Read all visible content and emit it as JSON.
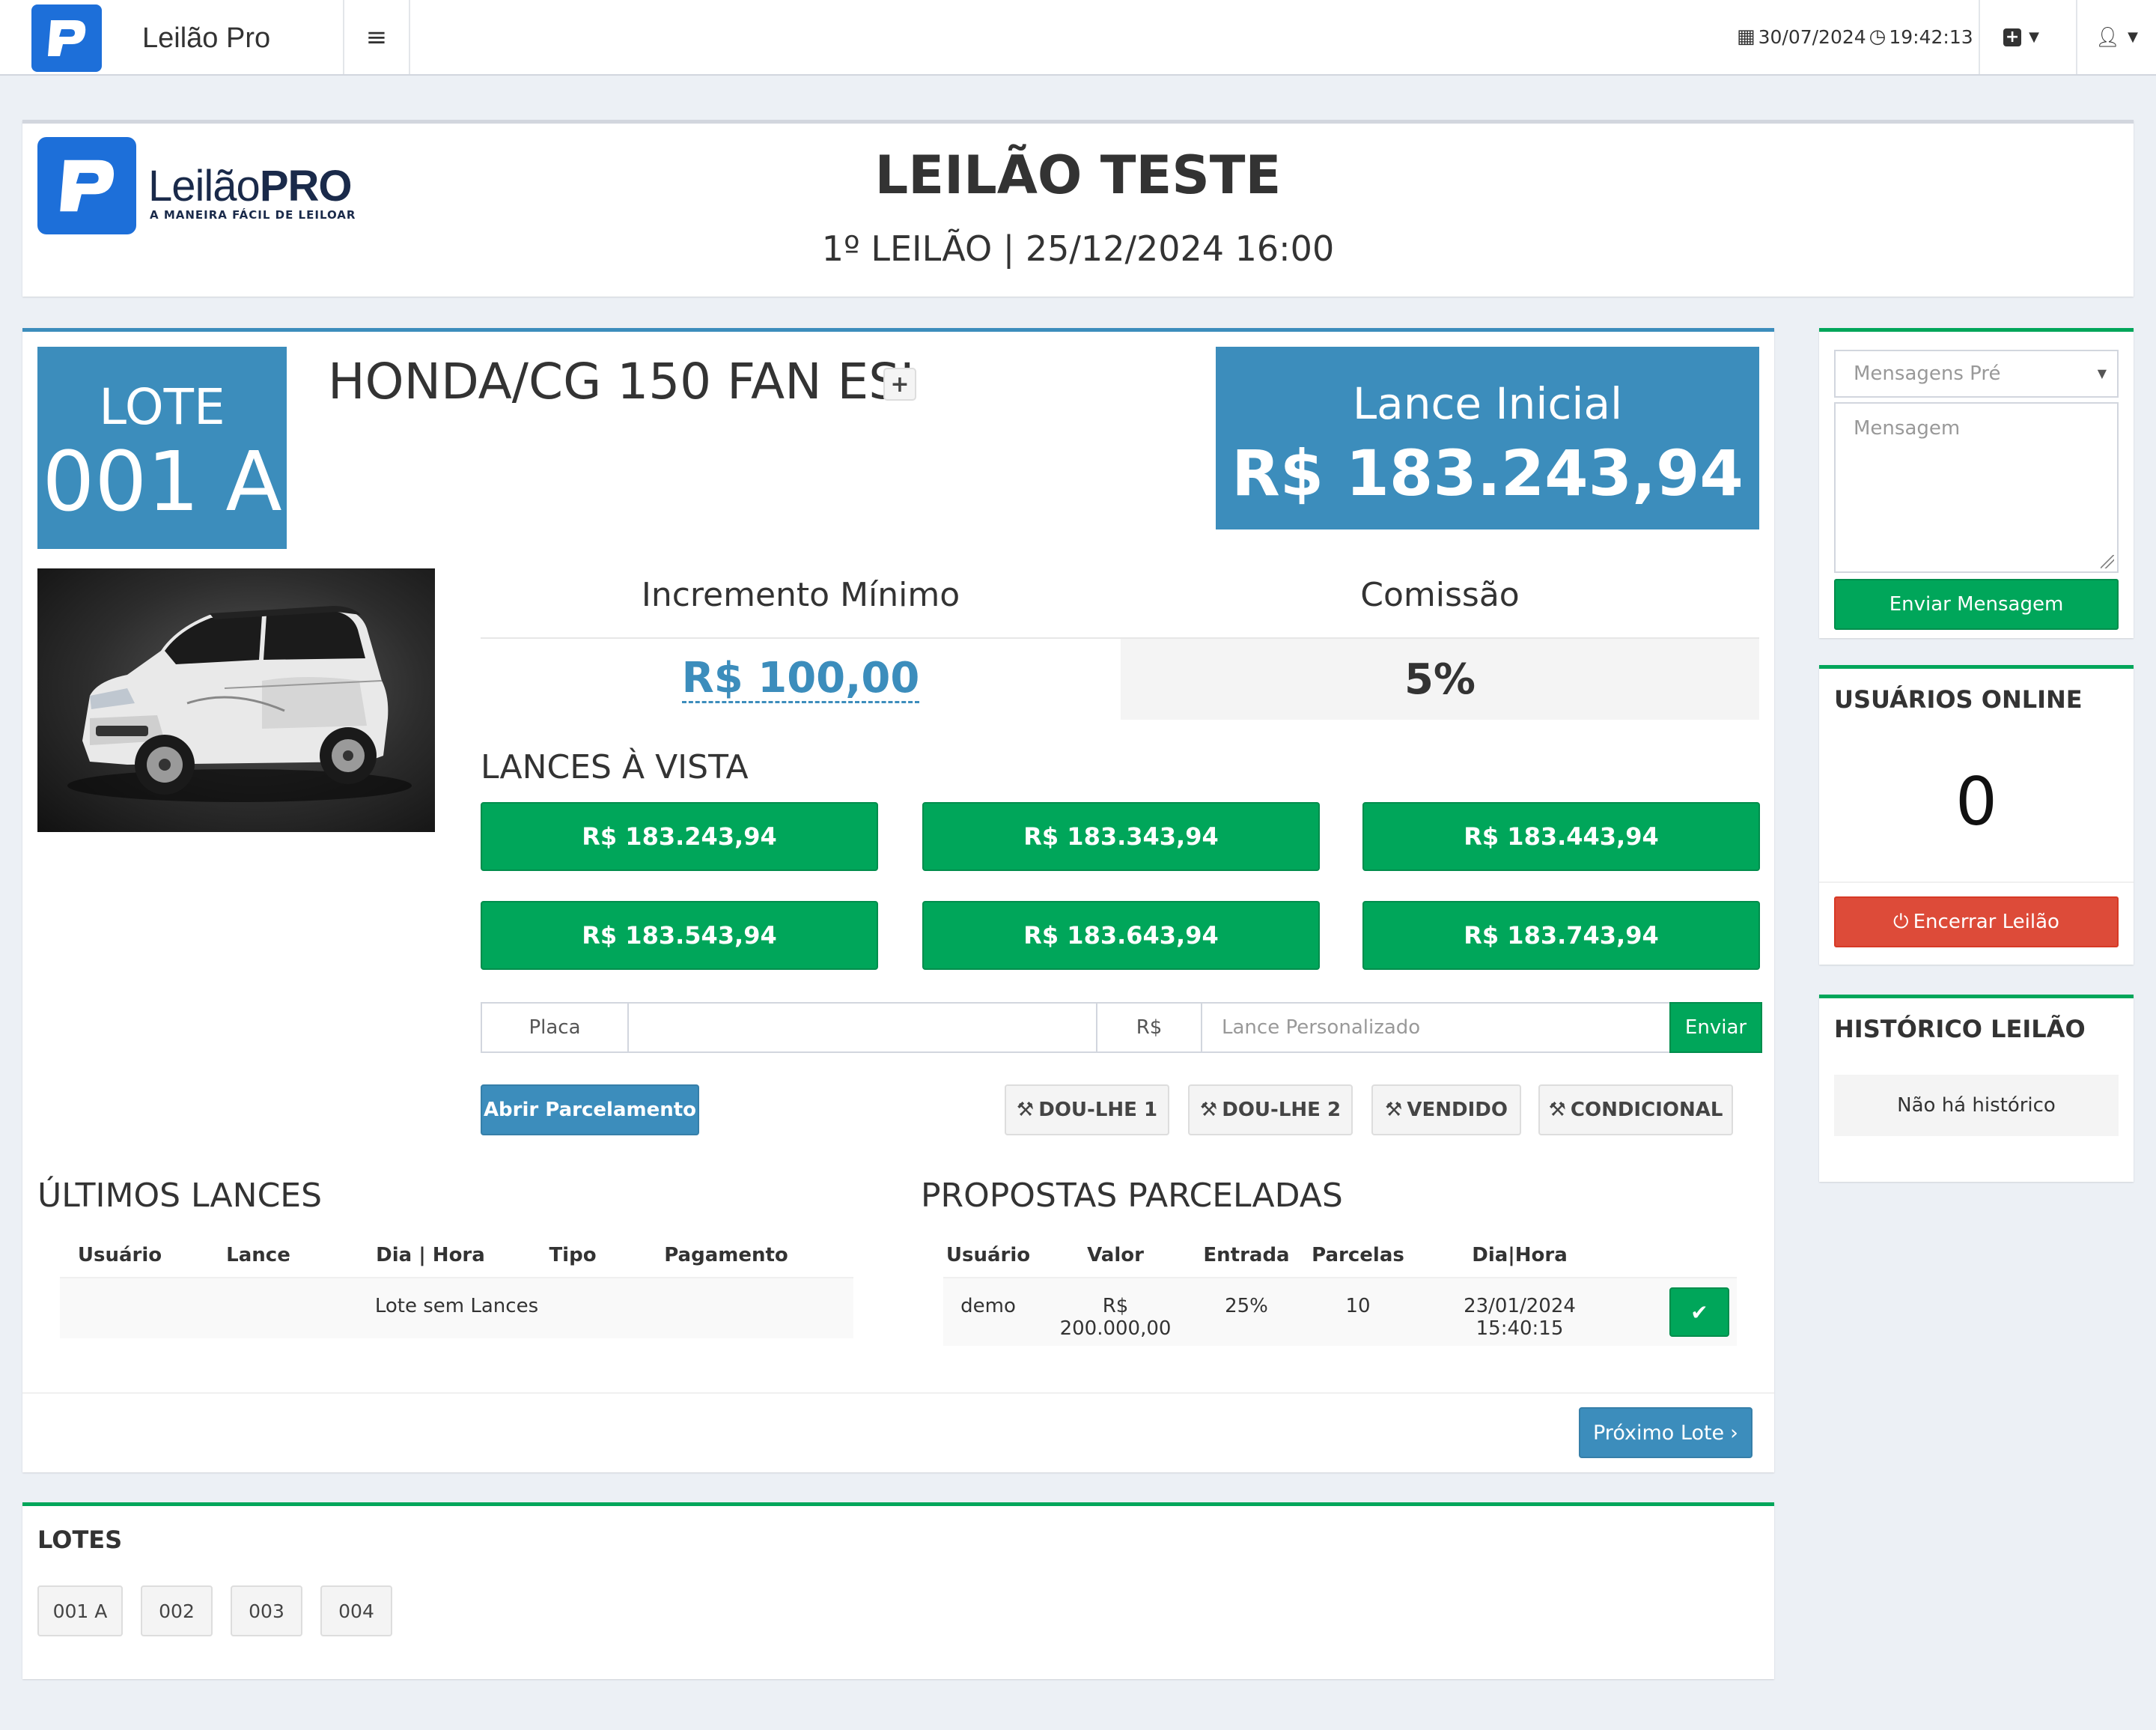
{
  "topbar": {
    "brand": "Leilão Pro",
    "date": "30/07/2024",
    "time": "19:42:13"
  },
  "header": {
    "logo_word_light": "Leilão",
    "logo_word_bold": "PRO",
    "logo_tagline": "A MANEIRA FÁCIL DE LEILOAR",
    "title": "LEILÃO TESTE",
    "subtitle": "1º LEILÃO | 25/12/2024 16:00"
  },
  "lot": {
    "badge_label": "LOTE",
    "badge_number": "001 A",
    "title": "HONDA/CG 150 FAN ESI",
    "plus": "+",
    "initial_bid_label": "Lance Inicial",
    "initial_bid_value": "R$ 183.243,94",
    "min_increment_label": "Incremento Mínimo",
    "min_increment_value": "R$ 100,00",
    "commission_label": "Comissão",
    "commission_value": "5%",
    "cash_bids_label": "LANCES À VISTA",
    "cash_bids": [
      "R$ 183.243,94",
      "R$ 183.343,94",
      "R$ 183.443,94",
      "R$ 183.543,94",
      "R$ 183.643,94",
      "R$ 183.743,94"
    ],
    "custom": {
      "plate_label": "Placa",
      "currency": "R$",
      "custom_placeholder": "Lance Personalizado",
      "send_label": "Enviar"
    },
    "open_installments_label": "Abrir Parcelamento",
    "actions": {
      "dou_lhe_1": "DOU-LHE 1",
      "dou_lhe_2": "DOU-LHE 2",
      "vendido": "VENDIDO",
      "condicional": "CONDICIONAL"
    },
    "last_bids": {
      "title": "ÚLTIMOS LANCES",
      "columns": [
        "Usuário",
        "Lance",
        "Dia | Hora",
        "Tipo",
        "Pagamento"
      ],
      "empty": "Lote sem Lances"
    },
    "proposals": {
      "title": "PROPOSTAS PARCELADAS",
      "columns": [
        "Usuário",
        "Valor",
        "Entrada",
        "Parcelas",
        "Dia|Hora"
      ],
      "rows": [
        [
          "demo",
          "R$ 200.000,00",
          "25%",
          "10",
          "23/01/2024 15:40:15"
        ]
      ]
    },
    "next_lot_label": "Próximo Lote"
  },
  "lots_panel": {
    "title": "LOTES",
    "lots": [
      "001 A",
      "002",
      "003",
      "004"
    ]
  },
  "messages": {
    "select_placeholder": "Mensagens Pré",
    "textarea_placeholder": "Mensagem",
    "send_label": "Enviar Mensagem"
  },
  "online": {
    "title": "USUÁRIOS ONLINE",
    "count": "0",
    "end_label": "Encerrar Leilão"
  },
  "history": {
    "title": "HISTÓRICO LEILÃO",
    "empty": "Não há histórico"
  },
  "colors": {
    "primary": "#3c8dbc",
    "success": "#00a65a",
    "danger": "#dd4b39",
    "logo_blue": "#1d6fd9"
  }
}
